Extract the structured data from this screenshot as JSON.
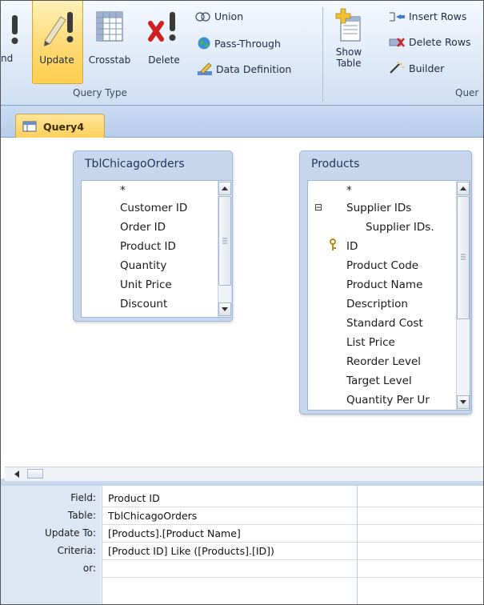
{
  "ribbon": {
    "partial_left_label": "nd",
    "update_label": "Update",
    "crosstab_label": "Crosstab",
    "delete_label": "Delete",
    "union_label": "Union",
    "passthrough_label": "Pass-Through",
    "data_definition_label": "Data Definition",
    "show_table_line1": "Show",
    "show_table_line2": "Table",
    "insert_rows_label": "Insert Rows",
    "delete_rows_label": "Delete Rows",
    "builder_label": "Builder",
    "group_query_type": "Query Type",
    "group_query_setup_partial": "Quer"
  },
  "document_tab": {
    "title": "Query4"
  },
  "tables": [
    {
      "title": "TblChicagoOrders",
      "fields": [
        "*",
        "Customer ID",
        "Order ID",
        "Product ID",
        "Quantity",
        "Unit Price",
        "Discount"
      ]
    },
    {
      "title": "Products",
      "fields": [
        "*",
        "Supplier IDs",
        "Supplier IDs.",
        "ID",
        "Product Code",
        "Product Name",
        "Description",
        "Standard Cost",
        "List Price",
        "Reorder Level",
        "Target Level",
        "Quantity Per Ur"
      ]
    }
  ],
  "grid": {
    "row_labels": [
      "Field:",
      "Table:",
      "Update To:",
      "Criteria:",
      "or:"
    ],
    "col1": {
      "field": "Product ID",
      "table": "TblChicagoOrders",
      "update_to": "[Products].[Product Name]",
      "criteria": "[Product ID] Like ([Products].[ID])",
      "or": ""
    }
  },
  "colors": {
    "ribbon_bg": "#dbe7f6",
    "update_highlight": "#ffd86e",
    "tab_active": "#ffcf5b",
    "table_box": "#c6d7ee"
  }
}
